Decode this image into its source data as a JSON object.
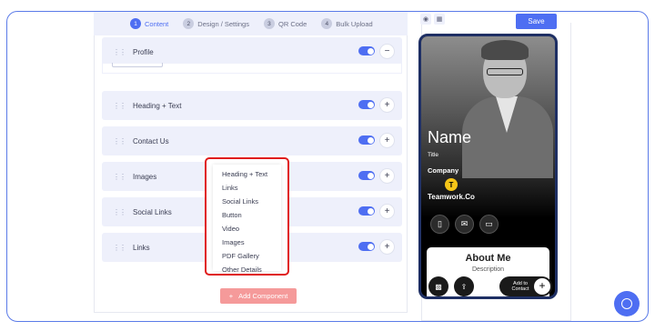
{
  "steps": [
    {
      "num": "1",
      "label": "Content"
    },
    {
      "num": "2",
      "label": "Design / Settings"
    },
    {
      "num": "3",
      "label": "QR Code"
    },
    {
      "num": "4",
      "label": "Bulk Upload"
    }
  ],
  "components": [
    {
      "label": "Profile",
      "action": "−"
    },
    {
      "label": "Heading + Text",
      "action": "+"
    },
    {
      "label": "Contact Us",
      "action": "+"
    },
    {
      "label": "Images",
      "action": "+"
    },
    {
      "label": "Social Links",
      "action": "+"
    },
    {
      "label": "Links",
      "action": "+"
    }
  ],
  "add_component": {
    "icon": "+",
    "label": "Add Component"
  },
  "dropdown": [
    "Heading + Text",
    "Links",
    "Social Links",
    "Button",
    "Video",
    "Images",
    "PDF Gallery",
    "Other Details"
  ],
  "toolbar": {
    "save_label": "Save",
    "view_icons": [
      "eye-icon",
      "grid-icon"
    ]
  },
  "preview": {
    "name": "Name",
    "title": "Title",
    "company": "Company",
    "logo_letter": "T",
    "brand": "Teamwork.Co",
    "contact_icons": [
      "phone-icon",
      "mail-icon",
      "chat-icon"
    ],
    "about_heading": "About Me",
    "about_desc": "Description",
    "add_to_contact": "Add to Contact",
    "add_plus": "+"
  },
  "colors": {
    "accent": "#4e6ef2",
    "highlight": "#e01b1b",
    "add_button": "#f59a9a"
  }
}
